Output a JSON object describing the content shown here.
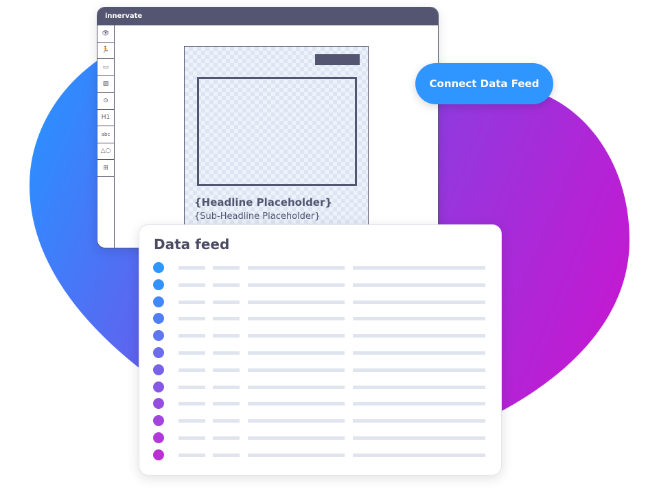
{
  "app": {
    "title": "innervate"
  },
  "toolbar": {
    "tools": [
      "eye-icon",
      "running-figure-icon",
      "layers-icon",
      "image-icon",
      "play-icon",
      "H1",
      "abc",
      "shapes-icon",
      "add-folder-icon"
    ]
  },
  "canvas": {
    "headline": "{Headline Placeholder}",
    "subheadline": "{Sub-Headline Placeholder}"
  },
  "connect_button": {
    "label": "Connect Data Feed",
    "color": "#2f95ff"
  },
  "data_feed": {
    "title": "Data feed",
    "row_count": 12,
    "dot_colors": [
      "#2e96ff",
      "#3591fc",
      "#4289f8",
      "#507ff4",
      "#5e76f0",
      "#6c6cec",
      "#7a62e8",
      "#8857e4",
      "#964ee0",
      "#a344dc",
      "#b03ad8",
      "#bc2fd4"
    ]
  },
  "colors": {
    "accent": "#545570",
    "blob_start": "#2f8cff",
    "blob_end": "#c21ad2"
  }
}
